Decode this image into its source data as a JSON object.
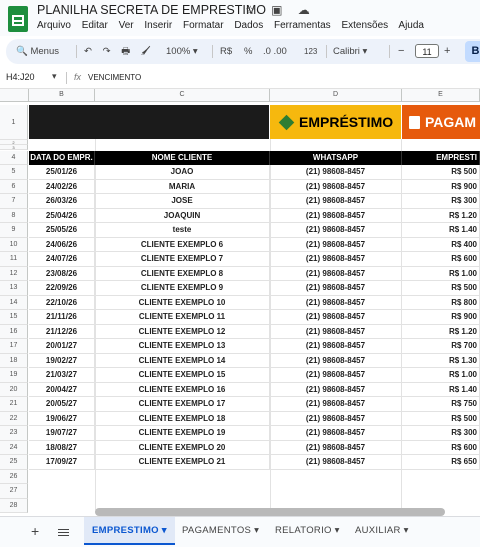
{
  "app": {
    "title": "PLANILHA SECRETA DE EMPRESTIMO",
    "title_icons": "☆ ▣ ☁",
    "menu": [
      "Arquivo",
      "Editar",
      "Ver",
      "Inserir",
      "Formatar",
      "Dados",
      "Ferramentas",
      "Extensões",
      "Ajuda"
    ]
  },
  "toolbar": {
    "menus_label": "🔍 Menus",
    "undo_redo": "↶ ↷ 🖶 🖌",
    "zoom": "100% ▾",
    "currency": "R$",
    "percent": "%",
    "decimals": ".0  .00",
    "number_format": "123",
    "font": "Calibri ▾",
    "font_size": "11",
    "font_size_minus": "−",
    "font_size_plus": "+",
    "bold": "B"
  },
  "formula_bar": {
    "cell_ref": "H4:J20",
    "fx": "fx",
    "content": "VENCIMENTO"
  },
  "columns": [
    "B",
    "C",
    "D",
    "E"
  ],
  "banners": {
    "emprestimo": "EMPRÉSTIMO",
    "pagamentos": "PAGAM"
  },
  "table": {
    "headers": [
      "DATA DO EMPR.",
      "NOME CLIENTE",
      "WHATSAPP",
      "EMPRESTI"
    ],
    "rows": [
      [
        "25/01/26",
        "JOAO",
        "(21) 98608-8457",
        "R$ 500"
      ],
      [
        "24/02/26",
        "MARIA",
        "(21) 98608-8457",
        "R$ 900"
      ],
      [
        "26/03/26",
        "JOSE",
        "(21) 98608-8457",
        "R$ 300"
      ],
      [
        "25/04/26",
        "JOAQUIN",
        "(21) 98608-8457",
        "R$ 1.20"
      ],
      [
        "25/05/26",
        "teste",
        "(21) 98608-8457",
        "R$ 1.40"
      ],
      [
        "24/06/26",
        "CLIENTE EXEMPLO 6",
        "(21) 98608-8457",
        "R$ 400"
      ],
      [
        "24/07/26",
        "CLIENTE EXEMPLO 7",
        "(21) 98608-8457",
        "R$ 600"
      ],
      [
        "23/08/26",
        "CLIENTE EXEMPLO 8",
        "(21) 98608-8457",
        "R$ 1.00"
      ],
      [
        "22/09/26",
        "CLIENTE EXEMPLO 9",
        "(21) 98608-8457",
        "R$ 500"
      ],
      [
        "22/10/26",
        "CLIENTE EXEMPLO 10",
        "(21) 98608-8457",
        "R$ 800"
      ],
      [
        "21/11/26",
        "CLIENTE EXEMPLO 11",
        "(21) 98608-8457",
        "R$ 900"
      ],
      [
        "21/12/26",
        "CLIENTE EXEMPLO 12",
        "(21) 98608-8457",
        "R$ 1.20"
      ],
      [
        "20/01/27",
        "CLIENTE EXEMPLO 13",
        "(21) 98608-8457",
        "R$ 700"
      ],
      [
        "19/02/27",
        "CLIENTE EXEMPLO 14",
        "(21) 98608-8457",
        "R$ 1.30"
      ],
      [
        "21/03/27",
        "CLIENTE EXEMPLO 15",
        "(21) 98608-8457",
        "R$ 1.00"
      ],
      [
        "20/04/27",
        "CLIENTE EXEMPLO 16",
        "(21) 98608-8457",
        "R$ 1.40"
      ],
      [
        "20/05/27",
        "CLIENTE EXEMPLO 17",
        "(21) 98608-8457",
        "R$ 750"
      ],
      [
        "19/06/27",
        "CLIENTE EXEMPLO 18",
        "(21) 98608-8457",
        "R$ 500"
      ],
      [
        "19/07/27",
        "CLIENTE EXEMPLO 19",
        "(21) 98608-8457",
        "R$ 300"
      ],
      [
        "18/08/27",
        "CLIENTE EXEMPLO 20",
        "(21) 98608-8457",
        "R$ 600"
      ],
      [
        "17/09/27",
        "CLIENTE EXEMPLO 21",
        "(21) 98608-8457",
        "R$ 650"
      ]
    ]
  },
  "row_numbers": [
    "1",
    "2",
    "3",
    "4",
    "5",
    "6",
    "7",
    "8",
    "9",
    "10",
    "11",
    "12",
    "13",
    "14",
    "15",
    "16",
    "17",
    "18",
    "19",
    "20",
    "21",
    "22",
    "23",
    "24",
    "25",
    "26",
    "27",
    "28"
  ],
  "sheet_tabs": {
    "add": "+",
    "tabs": [
      "EMPRESTIMO ▾",
      "PAGAMENTOS ▾",
      "RELATORIO ▾",
      "AUXILIAR ▾"
    ],
    "active": 0
  },
  "colors": {
    "header_black": "#000000",
    "banner_gold": "#f6b80e",
    "banner_orange": "#e65a0c",
    "accent_blue": "#0b57d0"
  }
}
